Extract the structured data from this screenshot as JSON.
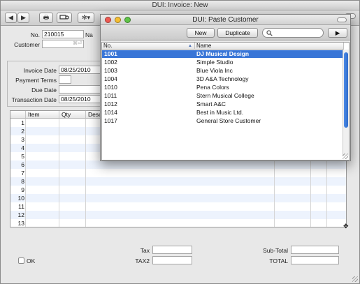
{
  "window": {
    "title": "DUI: Invoice: New"
  },
  "toolbar": {
    "prev": "◀",
    "next": "▶",
    "print": "🖶",
    "tools": "✻▾"
  },
  "invoice": {
    "no_label": "No.",
    "no_value": "210015",
    "na_label": "Na",
    "customer_label": "Customer",
    "customer_hint": "⌘⏎",
    "invoice_date_label": "Invoice Date",
    "invoice_date": "08/25/2010",
    "payment_terms_label": "Payment Terms",
    "due_date_label": "Due Date",
    "transaction_date_label": "Transaction Date",
    "transaction_date": "08/25/2010"
  },
  "grid": {
    "headers": [
      "Item",
      "Qty",
      "Descri"
    ],
    "rows": [
      "1",
      "2",
      "3",
      "4",
      "5",
      "6",
      "7",
      "8",
      "9",
      "10",
      "11",
      "12",
      "13"
    ]
  },
  "footer": {
    "ok_label": "OK",
    "tax_label": "Tax",
    "tax2_label": "TAX2",
    "subtotal_label": "Sub-Total",
    "total_label": "TOTAL"
  },
  "dialog": {
    "title": "DUI: Paste Customer",
    "new_button": "New",
    "duplicate_button": "Duplicate",
    "search_placeholder": "",
    "go_button": "▶",
    "col_no": "No.",
    "col_name": "Name",
    "customers": [
      {
        "no": "1001",
        "name": "DJ Musical Design",
        "selected": true
      },
      {
        "no": "1002",
        "name": "Simple Studio"
      },
      {
        "no": "1003",
        "name": "Blue Viola Inc"
      },
      {
        "no": "1004",
        "name": "3D A&A Technology"
      },
      {
        "no": "1010",
        "name": "Pena Colors"
      },
      {
        "no": "1011",
        "name": "Stern Musical College"
      },
      {
        "no": "1012",
        "name": "Smart A&C"
      },
      {
        "no": "1014",
        "name": "Best in Music Ltd."
      },
      {
        "no": "1017",
        "name": "General Store Customer"
      }
    ]
  },
  "colors": {
    "selection": "#3875d7",
    "close": "#ee5a52",
    "minimize": "#f5bd31",
    "zoom": "#5fc447"
  }
}
